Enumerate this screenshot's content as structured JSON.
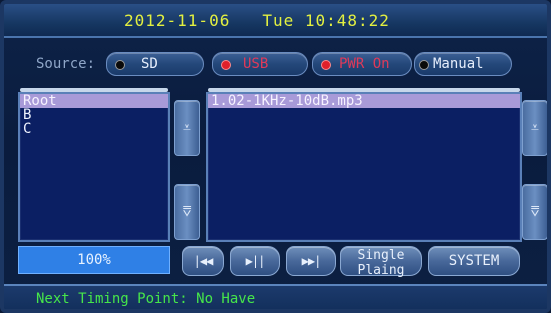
{
  "header": {
    "date": "2012-11-06",
    "time": "Tue 10:48:22"
  },
  "source": {
    "label": "Source:",
    "options": [
      {
        "label": "SD",
        "indicator": "black"
      },
      {
        "label": "USB",
        "indicator": "red"
      },
      {
        "label": "PWR On",
        "indicator": "red"
      },
      {
        "label": "Manual",
        "indicator": "black"
      }
    ]
  },
  "folders": {
    "items": [
      "Root",
      "B",
      "C"
    ],
    "selected": "Root"
  },
  "files": {
    "items": [
      "1.02-1KHz-10dB.mp3"
    ],
    "selected": "1.02-1KHz-10dB.mp3"
  },
  "volume": {
    "percent_label": "100%"
  },
  "controls": {
    "prev_icon": "prev-track-icon",
    "play_icon": "play-pause-icon",
    "next_icon": "next-track-icon",
    "mode_line1": "Single",
    "mode_line2": "Plaing",
    "system_label": "SYSTEM"
  },
  "status": {
    "text": "Next Timing Point: No Have"
  },
  "colors": {
    "clock_text": "#e3f040",
    "status_text": "#46e64a",
    "selection": "#a89ad8",
    "list_bg": "#0b1f63",
    "active_red": "#e0202a",
    "percent_bg": "#2f80e6"
  }
}
